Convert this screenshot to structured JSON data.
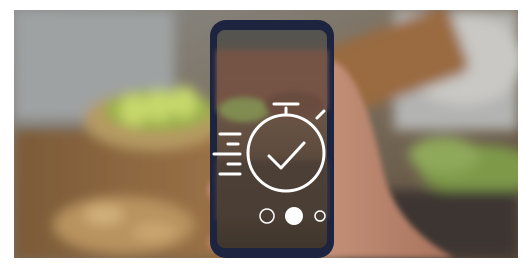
{
  "image": {
    "subject": "hand-holding-smartphone-photographing-food",
    "overlay_icon": "stopwatch-check-icon",
    "colors": {
      "overlay_tint": "#2b2a28",
      "icon_stroke": "#ffffff"
    }
  }
}
